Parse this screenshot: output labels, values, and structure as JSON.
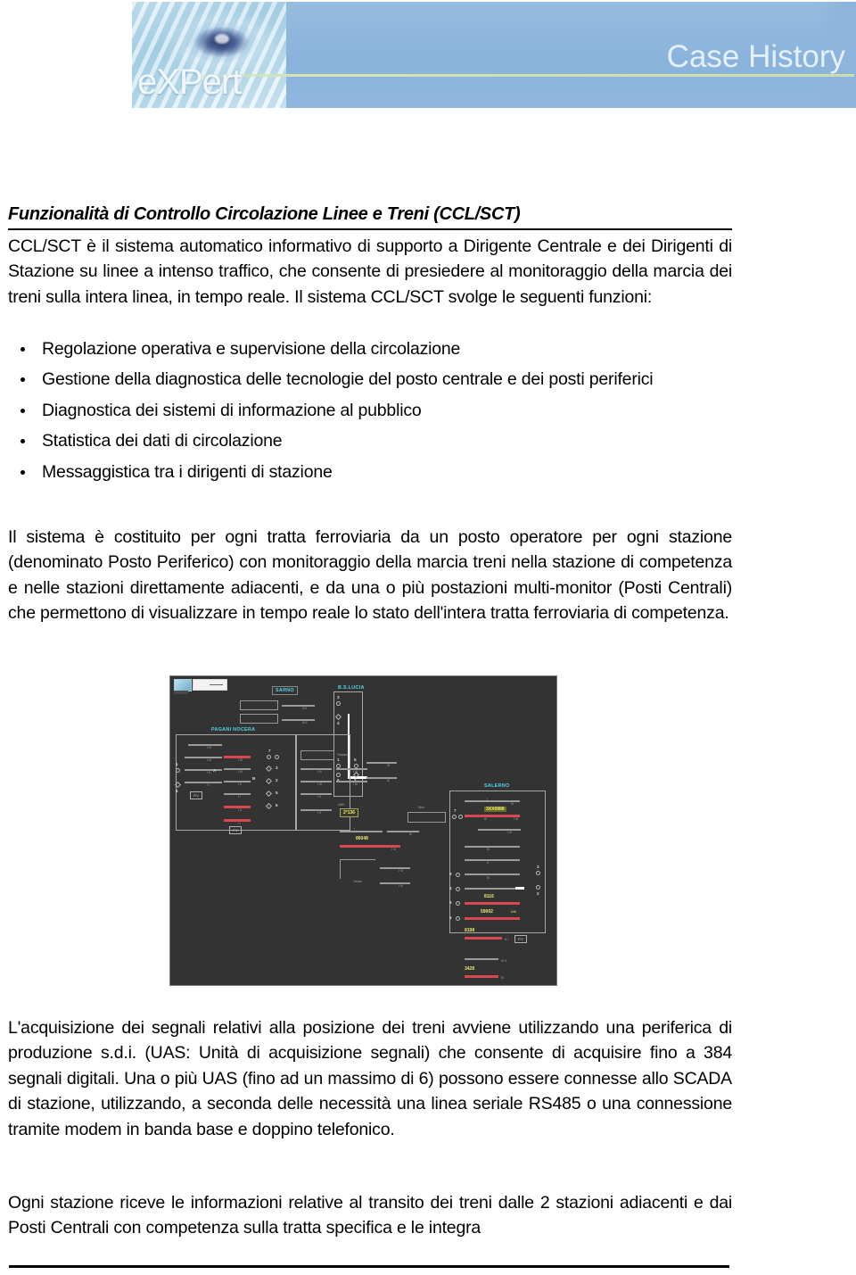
{
  "header": {
    "brand": "eXPert",
    "title": "Case History",
    "photo_alt": "eye-keyboard-photo"
  },
  "document": {
    "section_title": "Funzionalità di Controllo Circolazione Linee e Treni (CCL/SCT)",
    "para_intro": "CCL/SCT è il sistema automatico informativo di supporto a Dirigente Centrale e dei Dirigenti di Stazione su linee a intenso traffico, che consente di presiedere al monitoraggio della marcia dei treni sulla  intera linea, in tempo reale. Il sistema CCL/SCT svolge le seguenti funzioni:",
    "bullets": [
      "Regolazione operativa e supervisione della circolazione",
      "Gestione della diagnostica delle tecnologie del posto centrale e dei posti periferici",
      "Diagnostica dei sistemi di informazione al pubblico",
      "Statistica dei dati di circolazione",
      "Messaggistica tra i dirigenti di stazione"
    ],
    "para_system": "Il sistema è costituito per ogni tratta ferroviaria da un posto operatore per ogni stazione (denominato Posto Periferico) con monitoraggio della marcia treni nella stazione di competenza e nelle stazioni direttamente adiacenti, e da una o più postazioni multi-monitor (Posti Centrali) che permettono di visualizzare in tempo reale lo stato dell'intera tratta ferroviaria di competenza.",
    "para_acquisition": "L'acquisizione dei segnali relativi alla posizione dei treni avviene utilizzando una periferica di produzione s.d.i. (UAS: Unità di acquisizione segnali) che consente di acquisire fino a 384 segnali digitali. Una o più UAS (fino ad un massimo di 6) possono essere connesse allo SCADA di stazione, utilizzando, a seconda delle necessità una linea seriale RS485 o una connessione tramite modem in banda base e doppino telefonico.",
    "para_stations": "Ogni stazione riceve le informazioni relative al transito dei treni dalle 2 stazioni adiacenti e dai Posti Centrali con competenza sulla tratta specifica e le integra"
  },
  "scada": {
    "caption": "railway-control-screen",
    "stations": [
      {
        "name": "SARNO"
      },
      {
        "name": "B.S.LUCIA"
      },
      {
        "name": "PAGANI NOCERA"
      },
      {
        "name": "SALERNO"
      }
    ],
    "train_numbers": [
      "2*136",
      "3XX0988",
      "8116",
      "59002",
      "8198",
      "3428",
      "86048"
    ],
    "track_markers": [
      "1",
      "4",
      "7",
      "3",
      "2",
      "5",
      "6",
      "A",
      "B",
      "P.V"
    ],
    "colors": {
      "background": "#333333",
      "track_free": "#9a9a9a",
      "track_occupied": "#d9484e",
      "station_label": "#4fd5e8",
      "train_label": "#e9e96a"
    }
  },
  "theme": {
    "banner_blue": "#8ab3dc",
    "banner_rule_green": "#c9deab",
    "banner_title_color": "#e4f0fb",
    "text_color": "#000000"
  }
}
